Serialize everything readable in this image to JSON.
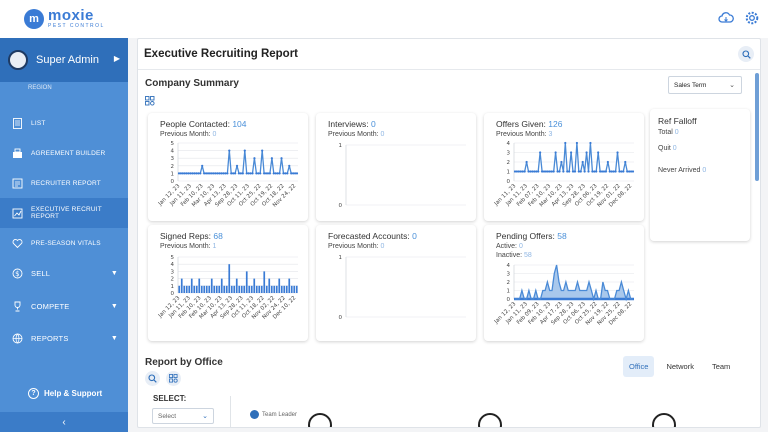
{
  "brand": {
    "mark": "m",
    "name": "moxie",
    "tagline": "PEST CONTROL"
  },
  "sidebar": {
    "user": "Super Admin",
    "partial_item": "REGION",
    "items": [
      {
        "label": "LIST",
        "icon": "list-icon"
      },
      {
        "label": "AGREEMENT BUILDER",
        "icon": "builder-icon"
      },
      {
        "label": "RECRUITER REPORT",
        "icon": "report-icon"
      },
      {
        "label": "EXECUTIVE RECRUIT REPORT",
        "icon": "exec-report-icon"
      },
      {
        "label": "PRE-SEASON VITALS",
        "icon": "heart-icon"
      },
      {
        "label": "SELL",
        "icon": "dollar-icon"
      },
      {
        "label": "COMPETE",
        "icon": "trophy-icon"
      },
      {
        "label": "REPORTS",
        "icon": "globe-icon"
      }
    ],
    "help": "Help & Support"
  },
  "page": {
    "title": "Executive Recruiting Report",
    "section_title": "Company Summary",
    "term_select": "Sales Term",
    "section2_title": "Report by Office",
    "tabs": [
      "Office",
      "Network",
      "Team"
    ],
    "select_label": "SELECT:",
    "select_placeholder": "Select",
    "legend_team_leader": "Team Leader"
  },
  "cards": {
    "people": {
      "label": "People Contacted:",
      "value": "104",
      "sub_label": "Previous Month:",
      "sub_value": "0"
    },
    "interviews": {
      "label": "Interviews:",
      "value": "0",
      "sub_label": "Previous Month:",
      "sub_value": "0"
    },
    "offers": {
      "label": "Offers Given:",
      "value": "126",
      "sub_label": "Previous Month:",
      "sub_value": "3"
    },
    "signed": {
      "label": "Signed Reps:",
      "value": "68",
      "sub_label": "Previous Month:",
      "sub_value": "1"
    },
    "forecast": {
      "label": "Forecasted Accounts:",
      "value": "0",
      "sub_label": "Previous Month:",
      "sub_value": "0"
    },
    "pending": {
      "label": "Pending Offers:",
      "value": "58",
      "active_label": "Active:",
      "active_value": "0",
      "inactive_label": "Inactive:",
      "inactive_value": "58"
    },
    "falloff": {
      "title": "Ref Falloff",
      "total_label": "Total",
      "total_value": "0",
      "quit_label": "Quit",
      "quit_value": "0",
      "never_label": "Never Arrived",
      "never_value": "0"
    }
  },
  "chart_data": [
    {
      "type": "line",
      "name": "People Contacted",
      "ylim": [
        0,
        5
      ],
      "yticks": [
        0,
        1,
        2,
        3,
        4,
        5
      ],
      "x_ticklabels": [
        "Jan 12, 23",
        "Jan 11, 23",
        "Feb 10, 23",
        "Mar 10, 23",
        "Apr 13, 23",
        "Sep 28, 23",
        "Oct 11, 23",
        "Oct 25, 22",
        "Oct 19, 22",
        "Oct 18, 22",
        "Nov 24, 22"
      ],
      "values": [
        1,
        1,
        1,
        1,
        1,
        1,
        1,
        1,
        1,
        1,
        1,
        1,
        2,
        1,
        1,
        1,
        1,
        1,
        1,
        1,
        1,
        1,
        1,
        1,
        1,
        1,
        4,
        1,
        1,
        1,
        2,
        1,
        1,
        1,
        4,
        1,
        1,
        1,
        1,
        3,
        1,
        1,
        1,
        4,
        1,
        1,
        1,
        1,
        3,
        1,
        1,
        1,
        1,
        3,
        1,
        1,
        1,
        2,
        1,
        1,
        1,
        1
      ]
    },
    {
      "type": "line",
      "name": "Interviews",
      "ylim": [
        0,
        1
      ],
      "yticks": [
        0,
        1
      ],
      "x_ticklabels": [],
      "values": []
    },
    {
      "type": "line",
      "name": "Offers Given",
      "ylim": [
        0,
        4
      ],
      "yticks": [
        0,
        1,
        2,
        3,
        4
      ],
      "x_ticklabels": [
        "Jan 11, 23",
        "Jan 11, 23",
        "Feb 07, 23",
        "Feb 10, 23",
        "Mar 10, 23",
        "Apr 13, 23",
        "Sep 28, 23",
        "Oct 06, 23",
        "Oct 19, 22",
        "Nov 01, 22",
        "Dec 08, 22"
      ],
      "values": [
        1,
        1,
        1,
        1,
        1,
        1,
        2,
        1,
        1,
        1,
        1,
        1,
        1,
        3,
        1,
        1,
        1,
        1,
        1,
        1,
        1,
        3,
        1,
        1,
        2,
        1,
        4,
        1,
        1,
        3,
        1,
        1,
        4,
        1,
        1,
        2,
        1,
        3,
        1,
        4,
        1,
        1,
        1,
        3,
        1,
        1,
        1,
        1,
        2,
        1,
        1,
        1,
        1,
        3,
        1,
        1,
        1,
        2,
        1,
        1,
        1,
        1
      ]
    },
    {
      "type": "bar",
      "name": "Signed Reps",
      "ylim": [
        0,
        5
      ],
      "yticks": [
        0,
        1,
        2,
        3,
        4,
        5
      ],
      "x_ticklabels": [
        "Jan 12, 23",
        "Jan 11, 23",
        "Feb 10, 23",
        "Feb 10, 23",
        "Mar 10, 23",
        "Apr 13, 23",
        "Sep 28, 23",
        "Oct 11, 23",
        "Oct 18, 22",
        "Nov 02, 22",
        "Nov 24, 22",
        "Dec 10, 22"
      ],
      "values": [
        1,
        2,
        1,
        1,
        1,
        2,
        1,
        1,
        2,
        1,
        1,
        1,
        1,
        2,
        1,
        1,
        1,
        2,
        1,
        1,
        4,
        1,
        1,
        2,
        1,
        1,
        1,
        3,
        1,
        1,
        2,
        1,
        1,
        1,
        3,
        1,
        2,
        1,
        1,
        1,
        2,
        1,
        1,
        1,
        2,
        1,
        1,
        1
      ]
    },
    {
      "type": "line",
      "name": "Forecasted Accounts",
      "ylim": [
        0,
        1
      ],
      "yticks": [
        0,
        1
      ],
      "x_ticklabels": [],
      "values": []
    },
    {
      "type": "area",
      "name": "Pending Offers",
      "ylim": [
        0,
        4
      ],
      "yticks": [
        0,
        1,
        2,
        3,
        4
      ],
      "x_ticklabels": [
        "Jan 12, 23",
        "Jan 11, 23",
        "Feb 09, 23",
        "Feb 10, 23",
        "Apr 17, 23",
        "Sep 28, 23",
        "Oct 06, 23",
        "Oct 25, 22",
        "Nov 19, 22",
        "Nov 25, 22",
        "Dec 08, 22"
      ],
      "values": [
        0,
        0,
        0,
        1,
        0,
        0,
        1,
        0,
        0,
        1,
        0,
        0,
        1,
        1,
        2,
        1,
        1,
        3,
        4,
        2,
        1,
        1,
        2,
        1,
        1,
        1,
        1,
        2,
        1,
        1,
        1,
        1,
        2,
        1,
        0,
        1,
        0,
        0,
        2,
        1,
        1,
        0,
        0,
        0,
        1,
        1,
        2,
        1,
        0,
        1,
        0,
        0
      ]
    }
  ]
}
